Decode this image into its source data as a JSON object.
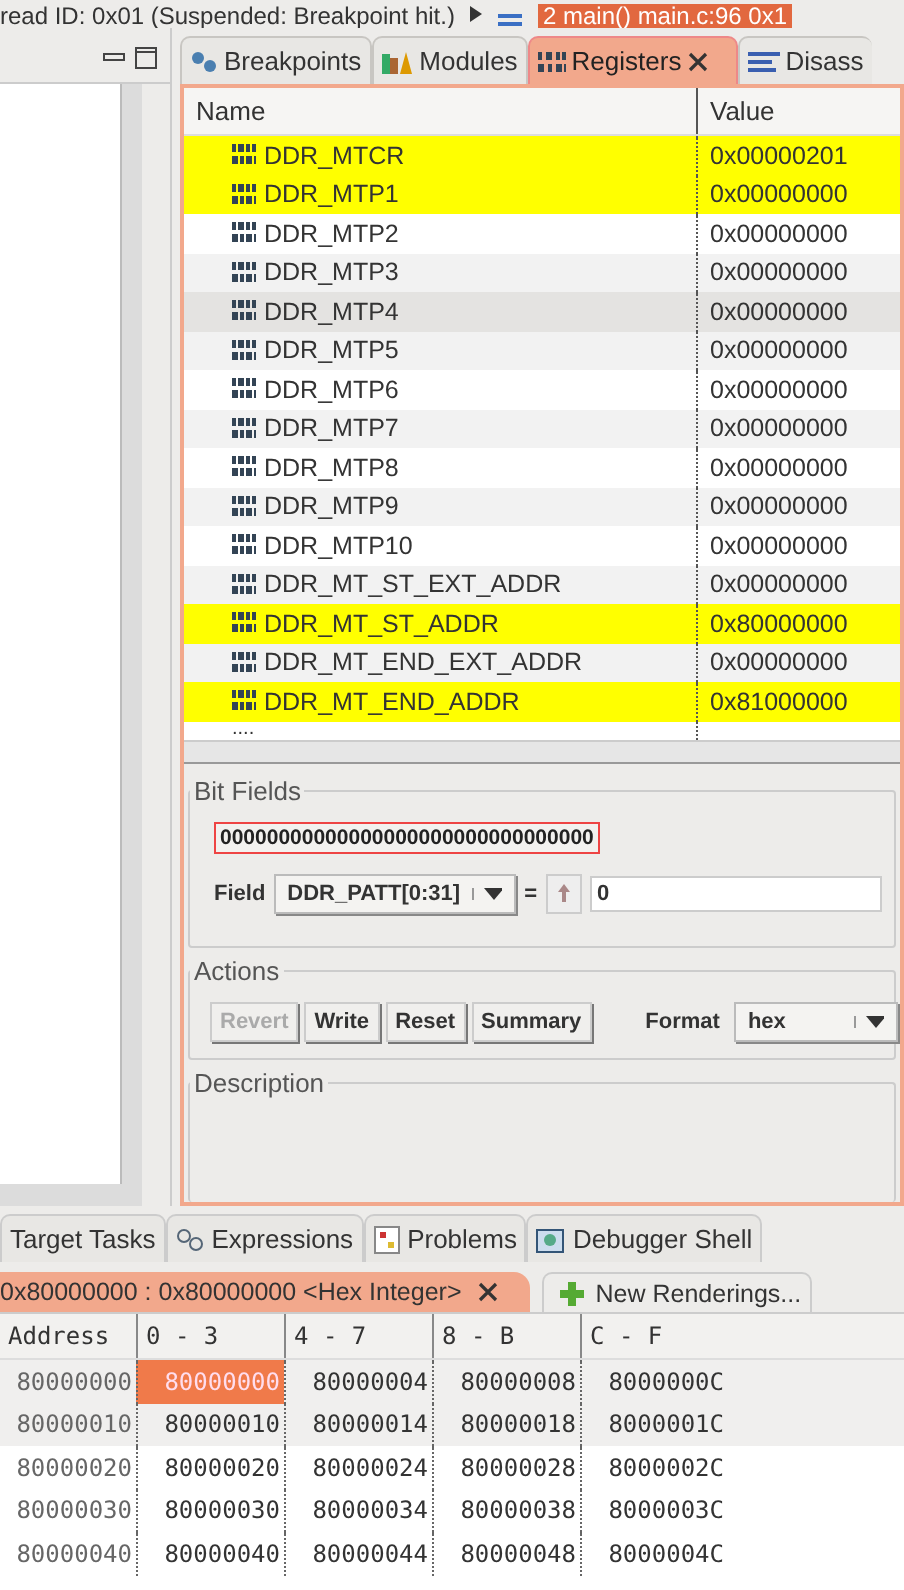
{
  "top_bar": {
    "thread": "read ID: 0x01 (Suspended: Breakpoint hit.)",
    "frame": "2 main() main.c:96 0x1"
  },
  "view_tabs": [
    {
      "label": "Breakpoints",
      "kind": "breakpoints",
      "selected": false
    },
    {
      "label": "Modules",
      "kind": "modules",
      "selected": false
    },
    {
      "label": "Registers",
      "kind": "registers",
      "selected": true
    },
    {
      "label": "Disass",
      "kind": "disassembly",
      "selected": false
    }
  ],
  "registers": {
    "columns": [
      "Name",
      "Value"
    ],
    "rows": [
      {
        "name": "DDR_MTCR",
        "value": "0x00000201",
        "changed": true,
        "selected": false
      },
      {
        "name": "DDR_MTP1",
        "value": "0x00000000",
        "changed": true,
        "selected": false
      },
      {
        "name": "DDR_MTP2",
        "value": "0x00000000",
        "changed": false,
        "selected": false
      },
      {
        "name": "DDR_MTP3",
        "value": "0x00000000",
        "changed": false,
        "selected": false
      },
      {
        "name": "DDR_MTP4",
        "value": "0x00000000",
        "changed": false,
        "selected": true
      },
      {
        "name": "DDR_MTP5",
        "value": "0x00000000",
        "changed": false,
        "selected": false
      },
      {
        "name": "DDR_MTP6",
        "value": "0x00000000",
        "changed": false,
        "selected": false
      },
      {
        "name": "DDR_MTP7",
        "value": "0x00000000",
        "changed": false,
        "selected": false
      },
      {
        "name": "DDR_MTP8",
        "value": "0x00000000",
        "changed": false,
        "selected": false
      },
      {
        "name": "DDR_MTP9",
        "value": "0x00000000",
        "changed": false,
        "selected": false
      },
      {
        "name": "DDR_MTP10",
        "value": "0x00000000",
        "changed": false,
        "selected": false
      },
      {
        "name": "DDR_MT_ST_EXT_ADDR",
        "value": "0x00000000",
        "changed": false,
        "selected": false
      },
      {
        "name": "DDR_MT_ST_ADDR",
        "value": "0x80000000",
        "changed": true,
        "selected": false
      },
      {
        "name": "DDR_MT_END_EXT_ADDR",
        "value": "0x00000000",
        "changed": false,
        "selected": false
      },
      {
        "name": "DDR_MT_END_ADDR",
        "value": "0x81000000",
        "changed": true,
        "selected": false
      }
    ],
    "more": "...."
  },
  "bit_fields": {
    "title": "Bit Fields",
    "bits": "00000000000000000000000000000000",
    "field_label": "Field",
    "field": "DDR_PATT[0:31]",
    "equals": "=",
    "value": "0"
  },
  "actions": {
    "title": "Actions",
    "buttons": [
      {
        "label": "Revert",
        "disabled": true
      },
      {
        "label": "Write",
        "disabled": false
      },
      {
        "label": "Reset",
        "disabled": false
      },
      {
        "label": "Summary",
        "disabled": false
      }
    ],
    "format_label": "Format",
    "format": "hex"
  },
  "description": {
    "title": "Description"
  },
  "bottom_tabs": [
    {
      "label": "Target Tasks",
      "kind": "plain",
      "selected": false
    },
    {
      "label": "Expressions",
      "kind": "expressions",
      "selected": false
    },
    {
      "label": "Problems",
      "kind": "problems",
      "selected": false
    },
    {
      "label": "Debugger Shell",
      "kind": "shell",
      "selected": false
    }
  ],
  "memory": {
    "rendering_tab": "0x80000000 : 0x80000000 <Hex Integer>",
    "new_rendering": "New Renderings...",
    "address_column": "Address",
    "columns": [
      "0 - 3",
      "4 - 7",
      "8 - B",
      "C - F"
    ],
    "rows": [
      {
        "address": "80000000",
        "cells": [
          {
            "text": "80000000",
            "selected": true
          },
          {
            "text": "80000004",
            "selected": false
          },
          {
            "text": "80000008",
            "selected": false
          },
          {
            "text": "8000000C",
            "selected": false
          }
        ]
      },
      {
        "address": "80000010",
        "cells": [
          {
            "text": "80000010",
            "selected": false
          },
          {
            "text": "80000014",
            "selected": false
          },
          {
            "text": "80000018",
            "selected": false
          },
          {
            "text": "8000001C",
            "selected": false
          }
        ]
      },
      {
        "address": "80000020",
        "cells": [
          {
            "text": "80000020",
            "selected": false
          },
          {
            "text": "80000024",
            "selected": false
          },
          {
            "text": "80000028",
            "selected": false
          },
          {
            "text": "8000002C",
            "selected": false
          }
        ]
      },
      {
        "address": "80000030",
        "cells": [
          {
            "text": "80000030",
            "selected": false
          },
          {
            "text": "80000034",
            "selected": false
          },
          {
            "text": "80000038",
            "selected": false
          },
          {
            "text": "8000003C",
            "selected": false
          }
        ]
      },
      {
        "address": "80000040",
        "cells": [
          {
            "text": "80000040",
            "selected": false
          },
          {
            "text": "80000044",
            "selected": false
          },
          {
            "text": "80000048",
            "selected": false
          },
          {
            "text": "8000004C",
            "selected": false
          }
        ]
      }
    ]
  }
}
